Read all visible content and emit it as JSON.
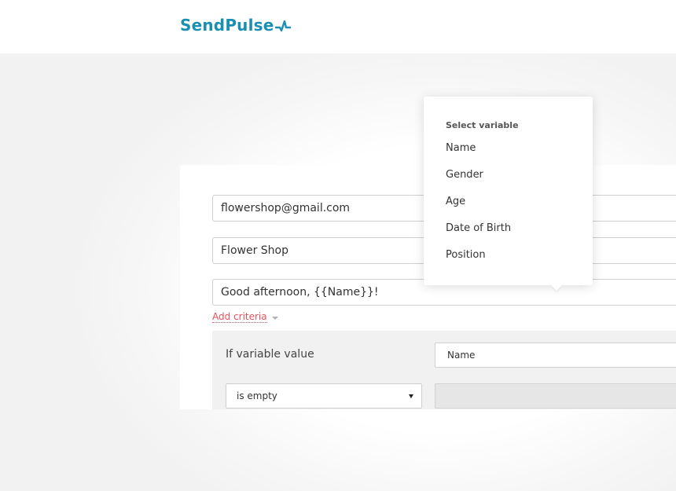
{
  "brand": {
    "logo_text": "SendPulse",
    "logo_icon": "pulse-line-icon",
    "logo_color": "#1a8fb1"
  },
  "form": {
    "sender_email": "flowershop@gmail.com",
    "sender_name": "Flower Shop",
    "subject": "Good afternoon, {{Name}}!"
  },
  "add_criteria": {
    "label": "Add criteria",
    "color": "#e8505b"
  },
  "criteria": {
    "label": "If variable value",
    "variable": "Name",
    "condition": "is empty",
    "value": ""
  },
  "variable_popup": {
    "title": "Select variable",
    "items": [
      "Name",
      "Gender",
      "Age",
      "Date of Birth",
      "Position"
    ]
  }
}
